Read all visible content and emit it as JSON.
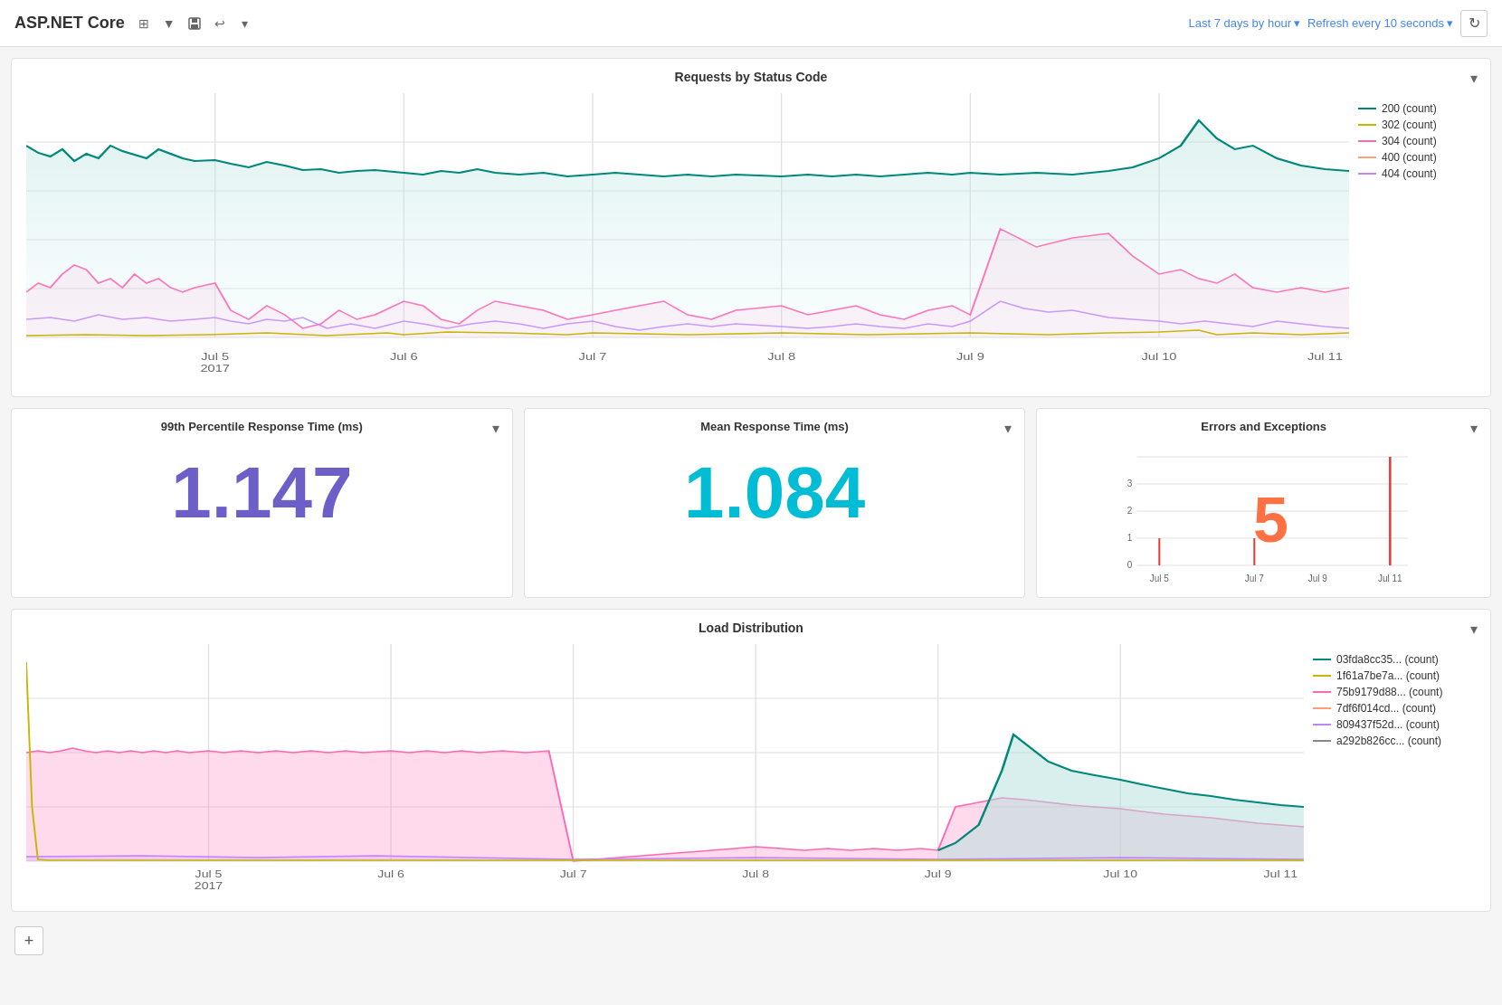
{
  "header": {
    "title": "ASP.NET Core",
    "time_range": "Last 7 days by hour",
    "time_range_arrow": "▾",
    "refresh_label": "Refresh every 10 seconds",
    "refresh_arrow": "▾"
  },
  "toolbar": {
    "grid_icon": "⊞",
    "filter_icon": "▼",
    "save_icon": "💾",
    "undo_icon": "↩",
    "more_icon": "▾",
    "refresh_icon": "↻"
  },
  "panels": {
    "requests_title": "Requests by Status Code",
    "percentile_title": "99th Percentile Response Time (ms)",
    "percentile_value": "1.147",
    "mean_title": "Mean Response Time (ms)",
    "mean_value": "1.084",
    "errors_title": "Errors and Exceptions",
    "errors_value": "5",
    "load_title": "Load Distribution"
  },
  "legend": {
    "status_codes": [
      {
        "label": "200 (count)",
        "color": "#00897b"
      },
      {
        "label": "302 (count)",
        "color": "#c6b800"
      },
      {
        "label": "304 (count)",
        "color": "#ff69b4"
      },
      {
        "label": "400 (count)",
        "color": "#ff9e7a"
      },
      {
        "label": "404 (count)",
        "color": "#c084fc"
      }
    ],
    "load_servers": [
      {
        "label": "03fda8cc35... (count)",
        "color": "#00897b"
      },
      {
        "label": "1f61a7be7a... (count)",
        "color": "#c6b800"
      },
      {
        "label": "75b9179d88... (count)",
        "color": "#ff69b4"
      },
      {
        "label": "7df6f014cd... (count)",
        "color": "#ff9e7a"
      },
      {
        "label": "809437f52d... (count)",
        "color": "#c084fc"
      },
      {
        "label": "a292b826cc... (count)",
        "color": "#888"
      }
    ]
  },
  "x_axis_top": [
    "Jul 5\n2017",
    "Jul 6",
    "Jul 7",
    "Jul 8",
    "Jul 9",
    "Jul 10",
    "Jul 11"
  ],
  "x_axis_bottom": [
    "Jul 5\n2017",
    "Jul 6",
    "Jul 7",
    "Jul 8",
    "Jul 9",
    "Jul 10",
    "Jul 11"
  ],
  "add_button_label": "+"
}
